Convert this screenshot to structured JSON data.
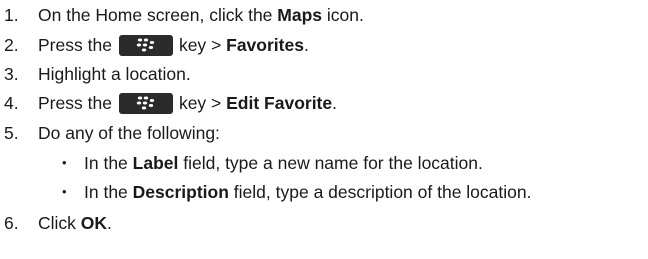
{
  "steps": [
    {
      "num": "1.",
      "pre": "On the Home screen, click the ",
      "bold": "Maps",
      "post": " icon."
    },
    {
      "num": "2.",
      "pre": "Press the",
      "key_icon": "blackberry-menu-key-icon",
      "post": "key > ",
      "bold": "Favorites",
      "end": "."
    },
    {
      "num": "3.",
      "text": "Highlight a location."
    },
    {
      "num": "4.",
      "pre": "Press the",
      "key_icon": "blackberry-menu-key-icon",
      "post": "key > ",
      "bold": "Edit Favorite",
      "end": "."
    },
    {
      "num": "5.",
      "text": "Do any of the following:"
    },
    {
      "num": "6.",
      "pre": "Click ",
      "bold": "OK",
      "end": "."
    }
  ],
  "substeps": [
    {
      "bullet": "•",
      "pre": "In the ",
      "bold": "Label",
      "post": " field, type a new name for the location."
    },
    {
      "bullet": "•",
      "pre": "In the ",
      "bold": "Description",
      "post": " field, type a description of the location."
    }
  ],
  "colors": {
    "text": "#1a1a1a",
    "key_background": "#2b2b2b",
    "key_glyph": "#ffffff"
  }
}
